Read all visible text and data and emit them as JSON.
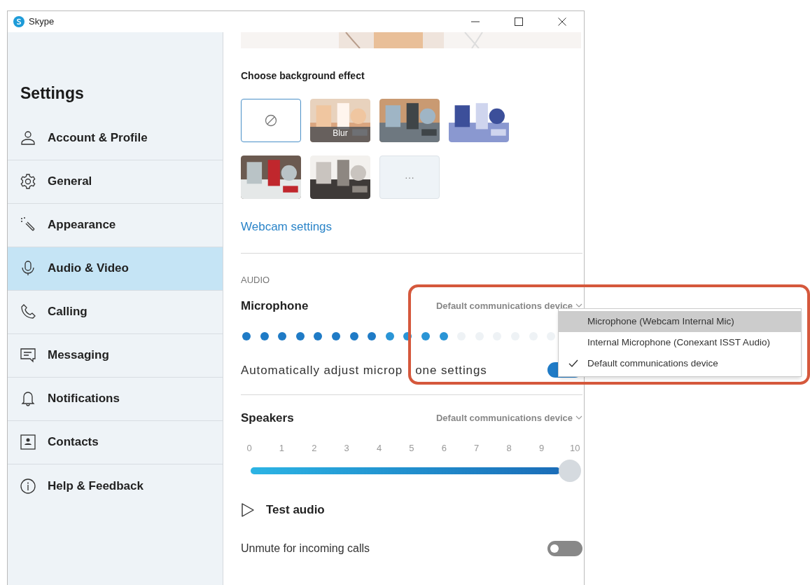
{
  "window": {
    "title": "Skype"
  },
  "sidebar": {
    "title": "Settings",
    "items": [
      {
        "label": "Account & Profile",
        "selected": false
      },
      {
        "label": "General",
        "selected": false
      },
      {
        "label": "Appearance",
        "selected": false
      },
      {
        "label": "Audio & Video",
        "selected": true
      },
      {
        "label": "Calling",
        "selected": false
      },
      {
        "label": "Messaging",
        "selected": false
      },
      {
        "label": "Notifications",
        "selected": false
      },
      {
        "label": "Contacts",
        "selected": false
      },
      {
        "label": "Help & Feedback",
        "selected": false
      }
    ]
  },
  "preview": {
    "kind": "picture"
  },
  "background_effects": {
    "title": "Choose background effect",
    "tiles": [
      {
        "kind": "none",
        "selected": true
      },
      {
        "kind": "picture",
        "label": "Blur",
        "selected": false
      },
      {
        "kind": "picture",
        "selected": false
      },
      {
        "kind": "picture",
        "selected": false
      },
      {
        "kind": "picture",
        "selected": false
      },
      {
        "kind": "picture",
        "selected": false
      },
      {
        "kind": "more",
        "label": "···"
      }
    ]
  },
  "webcam_settings_link": "Webcam settings",
  "audio": {
    "heading": "AUDIO",
    "microphone": {
      "label": "Microphone",
      "device": "Default communications device",
      "level": 0.6,
      "auto_adjust": {
        "label_parts": [
          "Automatically adjust microp",
          "one settings"
        ],
        "on": true
      }
    },
    "speakers": {
      "label": "Speakers",
      "device": "Default communications device",
      "ticks": [
        "0",
        "1",
        "2",
        "3",
        "4",
        "5",
        "6",
        "7",
        "8",
        "9",
        "10"
      ],
      "level": 1
    },
    "test_audio": "Test audio",
    "unmute": {
      "label": "Unmute for incoming calls",
      "on": false
    }
  },
  "device_menu": {
    "items": [
      {
        "label": "Microphone (Webcam Internal Mic)",
        "highlighted": true,
        "selected": false
      },
      {
        "label": "Internal Microphone (Conexant ISST Audio)",
        "highlighted": false,
        "selected": false
      },
      {
        "label": "Default communications device",
        "highlighted": false,
        "selected": true
      }
    ]
  }
}
